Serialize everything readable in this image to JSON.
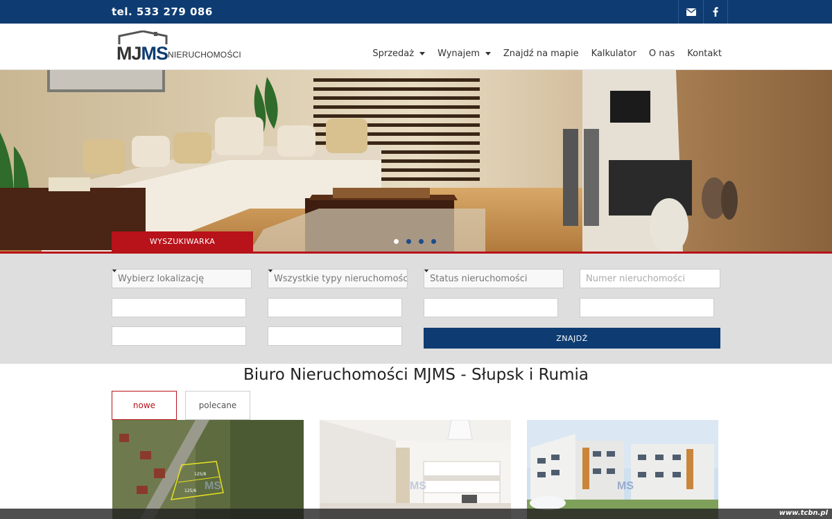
{
  "topbar": {
    "phone": "tel. 533 279 086",
    "icons": [
      "envelope-icon",
      "facebook-icon"
    ]
  },
  "header": {
    "logo_main_dark": "MJ",
    "logo_main_blue": "MS",
    "logo_sub": "NIERUCHOMOŚCI",
    "nav": [
      {
        "label": "Sprzedaż",
        "dropdown": true
      },
      {
        "label": "Wynajem",
        "dropdown": true
      },
      {
        "label": "Znajdź na mapie",
        "dropdown": false
      },
      {
        "label": "Kalkulator",
        "dropdown": false
      },
      {
        "label": "O nas",
        "dropdown": false
      },
      {
        "label": "Kontakt",
        "dropdown": false
      }
    ]
  },
  "hero": {
    "search_tab": "WYSZUKIWARKA",
    "slides": 4,
    "active_slide": 1
  },
  "search": {
    "location_placeholder": "Wybierz lokalizację",
    "type_placeholder": "Wszystkie typy nieruchomości",
    "status_placeholder": "Status nieruchomości",
    "number_placeholder": "Numer nieruchomości",
    "submit_label": "ZNAJDŹ"
  },
  "content": {
    "title": "Biuro Nieruchomości MJMS - Słupsk i Rumia",
    "tabs": [
      {
        "label": "nowe",
        "active": true
      },
      {
        "label": "polecane",
        "active": false
      }
    ],
    "card_labels": [
      "125/8",
      "125/6"
    ]
  },
  "footer": {
    "credit": "www.tcbn.pl"
  },
  "colors": {
    "navy": "#0e3c72",
    "red": "#b8121a",
    "search_bg": "#dedede"
  }
}
